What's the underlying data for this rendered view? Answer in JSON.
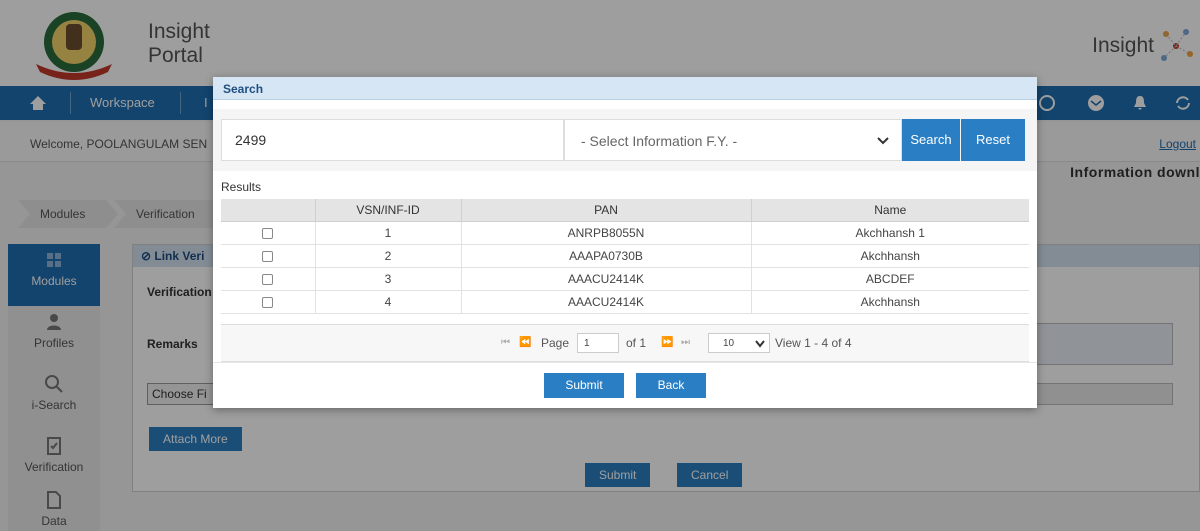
{
  "header": {
    "portal_title_line1": "Insight",
    "portal_title_line2": "Portal",
    "brand": "Insight"
  },
  "navbar": {
    "items": [
      {
        "label": "Workspace"
      },
      {
        "label": "I"
      }
    ],
    "icons": [
      "home-icon",
      "check-circle-icon",
      "envelope-icon",
      "bell-icon",
      "refresh-icon"
    ]
  },
  "user_bar": {
    "welcome": "Welcome, POOLANGULAM SEN",
    "logout": "Logout",
    "info_download": "Information downl"
  },
  "breadcrumb": [
    "Modules",
    "Verification"
  ],
  "sidebar": {
    "items": [
      {
        "label": "Modules",
        "icon": "grid-icon",
        "active": true
      },
      {
        "label": "Profiles",
        "icon": "user-icon",
        "active": false
      },
      {
        "label": "i-Search",
        "icon": "search-icon",
        "active": false
      },
      {
        "label": "Verification",
        "icon": "document-check-icon",
        "active": false
      },
      {
        "label": "Data",
        "icon": "document-icon",
        "active": false
      }
    ]
  },
  "background_form": {
    "panel_title": "Link Veri",
    "verification_label": "Verification",
    "remarks_label": "Remarks",
    "choose_file": "Choose Fi",
    "attach_more": "Attach More",
    "submit": "Submit",
    "cancel": "Cancel"
  },
  "modal": {
    "title": "Search",
    "search_value": "2499",
    "fy_select": {
      "selected": "- Select Information F.Y. -"
    },
    "search_button": "Search",
    "reset_button": "Reset",
    "results_label": "Results",
    "table": {
      "columns": [
        "",
        "VSN/INF-ID",
        "PAN",
        "Name"
      ],
      "rows": [
        {
          "id": "1",
          "pan": "ANRPB8055N",
          "name": "Akchhansh 1"
        },
        {
          "id": "2",
          "pan": "AAAPA0730B",
          "name": "Akchhansh"
        },
        {
          "id": "3",
          "pan": "AAACU2414K",
          "name": "ABCDEF"
        },
        {
          "id": "4",
          "pan": "AAACU2414K",
          "name": "Akchhansh"
        }
      ]
    },
    "pager": {
      "page_label": "Page",
      "page_value": "1",
      "of_label": "of 1",
      "rows_per_page": "10",
      "view_text": "View 1 - 4 of 4"
    },
    "submit_button": "Submit",
    "back_button": "Back"
  },
  "colors": {
    "primary": "#2a7fc4",
    "navbar": "#1f6eb0",
    "modal_header": "#d7e6f4"
  }
}
